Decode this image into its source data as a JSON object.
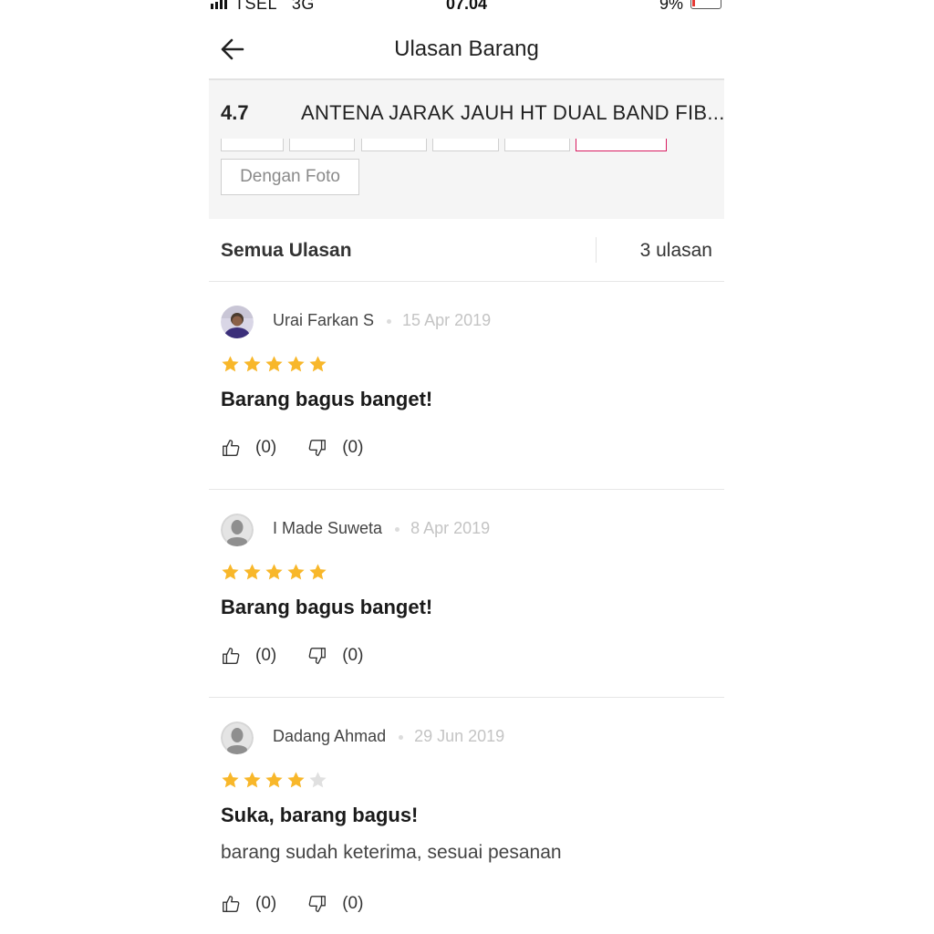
{
  "status_bar": {
    "carrier": "TSEL   3G",
    "time": "07.04",
    "battery": "9%"
  },
  "header": {
    "title": "Ulasan Barang",
    "back_icon": "arrow-left-icon"
  },
  "product": {
    "rating": "4.7",
    "name": "ANTENA JARAK JAUH HT DUAL BAND FIB..."
  },
  "filters": {
    "photo_label": "Dengan Foto"
  },
  "all_reviews": {
    "label": "Semua Ulasan",
    "count": "3 ulasan"
  },
  "colors": {
    "star_filled": "#f8b72a",
    "star_empty": "#e0e0e0",
    "active_filter": "#d81b60"
  },
  "reviews": [
    {
      "name": "Urai Farkan S",
      "date": "15 Apr 2019",
      "stars": 5,
      "title": "Barang bagus banget!",
      "body": "",
      "likes": "(0)",
      "dislikes": "(0)",
      "avatar": "user-photo"
    },
    {
      "name": "I Made Suweta",
      "date": "8 Apr 2019",
      "stars": 5,
      "title": "Barang bagus banget!",
      "body": "",
      "likes": "(0)",
      "dislikes": "(0)",
      "avatar": "default-avatar"
    },
    {
      "name": "Dadang Ahmad",
      "date": "29 Jun 2019",
      "stars": 4,
      "title": "Suka, barang bagus!",
      "body": "barang sudah keterima, sesuai pesanan",
      "likes": "(0)",
      "dislikes": "(0)",
      "avatar": "default-avatar"
    }
  ]
}
